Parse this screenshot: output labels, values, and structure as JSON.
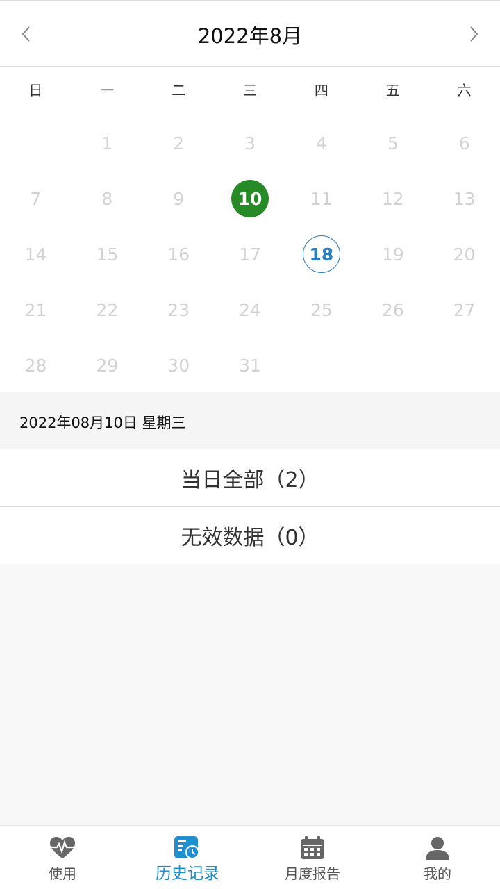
{
  "header": {
    "title": "2022年8月",
    "prev_icon": "chevron-left-icon",
    "next_icon": "chevron-right-icon"
  },
  "calendar": {
    "weekdays": [
      "日",
      "一",
      "二",
      "三",
      "四",
      "五",
      "六"
    ],
    "first_weekday_index": 1,
    "days_in_month": 31,
    "selected_day": 10,
    "today": 18,
    "colors": {
      "selected": "#268b27",
      "today": "#2a7fc1",
      "inactive_day": "#d2d2d2"
    }
  },
  "selected_date": {
    "text": "2022年08月10日 星期三"
  },
  "list": {
    "items": [
      {
        "label": "当日全部（2）"
      },
      {
        "label": "无效数据（0）"
      }
    ]
  },
  "tabbar": {
    "tabs": [
      {
        "label": "使用",
        "icon": "heartbeat-icon",
        "active": false
      },
      {
        "label": "历史记录",
        "icon": "history-icon",
        "active": true
      },
      {
        "label": "月度报告",
        "icon": "calendar-icon",
        "active": false
      },
      {
        "label": "我的",
        "icon": "user-icon",
        "active": false
      }
    ],
    "active_color": "#1e8fcf",
    "inactive_color": "#555555"
  }
}
